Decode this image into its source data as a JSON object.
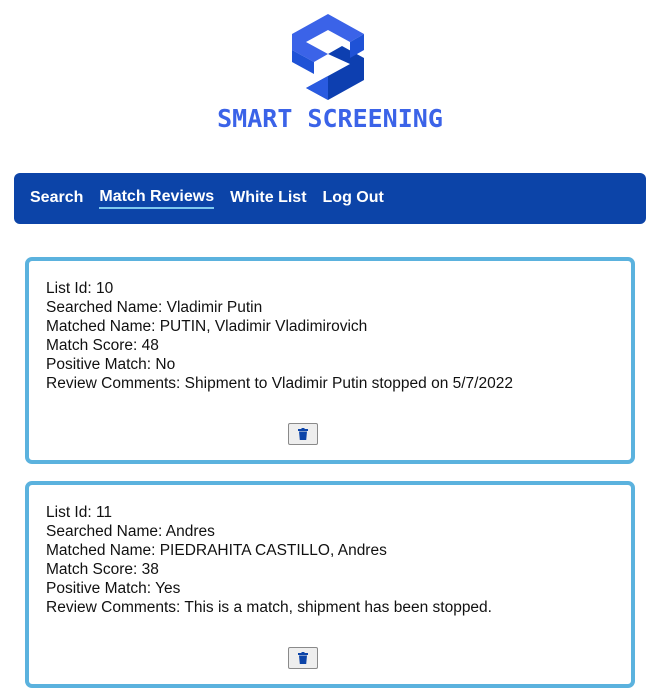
{
  "brand": {
    "name": "SMART SCREENING"
  },
  "nav": {
    "items": [
      {
        "label": "Search"
      },
      {
        "label": "Match Reviews",
        "active": true
      },
      {
        "label": "White List"
      },
      {
        "label": "Log Out"
      }
    ]
  },
  "reviews": [
    {
      "list_id": "List Id: 10",
      "searched_name": "Searched Name: Vladimir Putin",
      "matched_name": "Matched Name: PUTIN, Vladimir Vladimirovich",
      "match_score": "Match Score: 48",
      "positive_match": "Positive Match: No",
      "review_comments": "Review Comments: Shipment to Vladimir Putin stopped on 5/7/2022",
      "delete_icon": "trash-icon"
    },
    {
      "list_id": "List Id: 11",
      "searched_name": "Searched Name: Andres",
      "matched_name": "Matched Name: PIEDRAHITA CASTILLO, Andres",
      "match_score": "Match Score: 38",
      "positive_match": "Positive Match: Yes",
      "review_comments": "Review Comments: This is a match, shipment has been stopped.",
      "delete_icon": "trash-icon"
    }
  ],
  "colors": {
    "nav_background": "#0c44a8",
    "card_border": "#5bb2de",
    "brand_blue": "#3b63e8",
    "brand_dark": "#0d3fb0"
  }
}
